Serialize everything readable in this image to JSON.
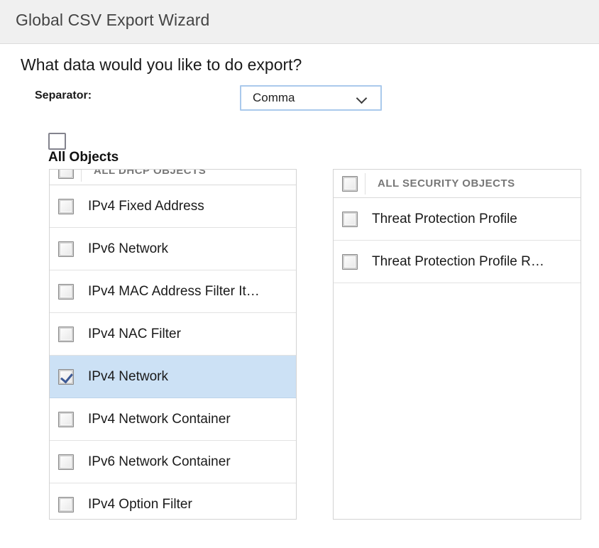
{
  "window": {
    "title": "Global CSV Export Wizard"
  },
  "form": {
    "question": "What data would you like to do export?",
    "separator_label": "Separator:",
    "separator_value": "Comma",
    "separator_options": [
      "Comma"
    ],
    "chevron_icon": "chevron-down-icon",
    "all_objects_label": "All Objects",
    "all_objects_checked": false
  },
  "panels": {
    "left": {
      "header": {
        "label": "ALL DHCP OBJECTS",
        "checked": false
      },
      "scrolled": true,
      "rows": [
        {
          "label": "IPv4 Fixed Address",
          "checked": false,
          "selected": false
        },
        {
          "label": "IPv6 Network",
          "checked": false,
          "selected": false
        },
        {
          "label": "IPv4 MAC Address Filter It…",
          "checked": false,
          "selected": false
        },
        {
          "label": "IPv4 NAC Filter",
          "checked": false,
          "selected": false
        },
        {
          "label": "IPv4 Network",
          "checked": true,
          "selected": true
        },
        {
          "label": "IPv4 Network Container",
          "checked": false,
          "selected": false
        },
        {
          "label": "IPv6 Network Container",
          "checked": false,
          "selected": false
        },
        {
          "label": "IPv4 Option Filter",
          "checked": false,
          "selected": false
        }
      ]
    },
    "right": {
      "header": {
        "label": "ALL SECURITY OBJECTS",
        "checked": false
      },
      "scrolled": false,
      "rows": [
        {
          "label": "Threat Protection Profile",
          "checked": false,
          "selected": false
        },
        {
          "label": "Threat Protection Profile R…",
          "checked": false,
          "selected": false
        }
      ]
    }
  },
  "colors": {
    "titlebar_bg": "#f0f0f0",
    "selection_bg": "#cce1f5",
    "check_mark": "#3d5a96",
    "select_border": "#aac9ec",
    "panel_border": "#d3d3d3"
  }
}
